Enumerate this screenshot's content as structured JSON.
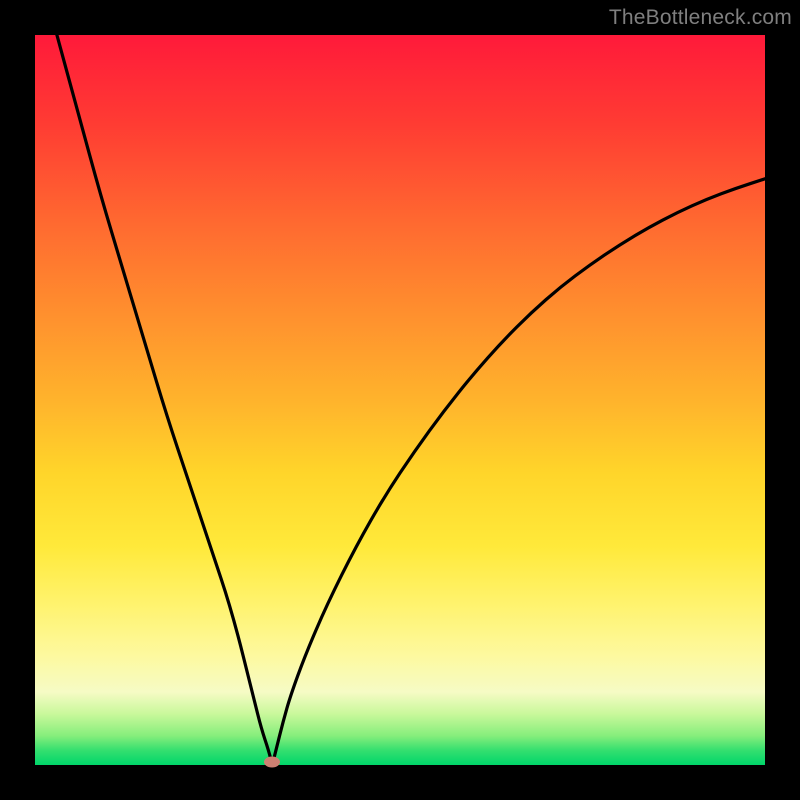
{
  "watermark": {
    "text": "TheBottleneck.com"
  },
  "colors": {
    "frame": "#000000",
    "curve": "#000000",
    "marker": "#cd8072",
    "gradient_top": "#ff1a3a",
    "gradient_bottom": "#00d66a"
  },
  "chart_data": {
    "type": "line",
    "title": "",
    "xlabel": "",
    "ylabel": "",
    "xlim": [
      0,
      100
    ],
    "ylim": [
      0,
      100
    ],
    "grid": false,
    "legend": false,
    "annotations": [],
    "x": [
      3,
      6,
      9,
      12,
      15,
      18,
      21,
      24,
      27,
      30,
      31,
      32,
      32.5,
      33,
      34,
      35,
      37,
      40,
      44,
      48,
      52,
      56,
      60,
      64,
      68,
      72,
      76,
      80,
      84,
      88,
      92,
      96,
      100
    ],
    "values": [
      100,
      89,
      78,
      68,
      58,
      48,
      39,
      30,
      21,
      9,
      5,
      2,
      0,
      2,
      6,
      9.5,
      15,
      22,
      30,
      37,
      43,
      48.5,
      53.5,
      58,
      62,
      65.5,
      68.5,
      71.2,
      73.6,
      75.7,
      77.5,
      79,
      80.3
    ],
    "marker": {
      "x": 32.5,
      "y": 0
    }
  }
}
